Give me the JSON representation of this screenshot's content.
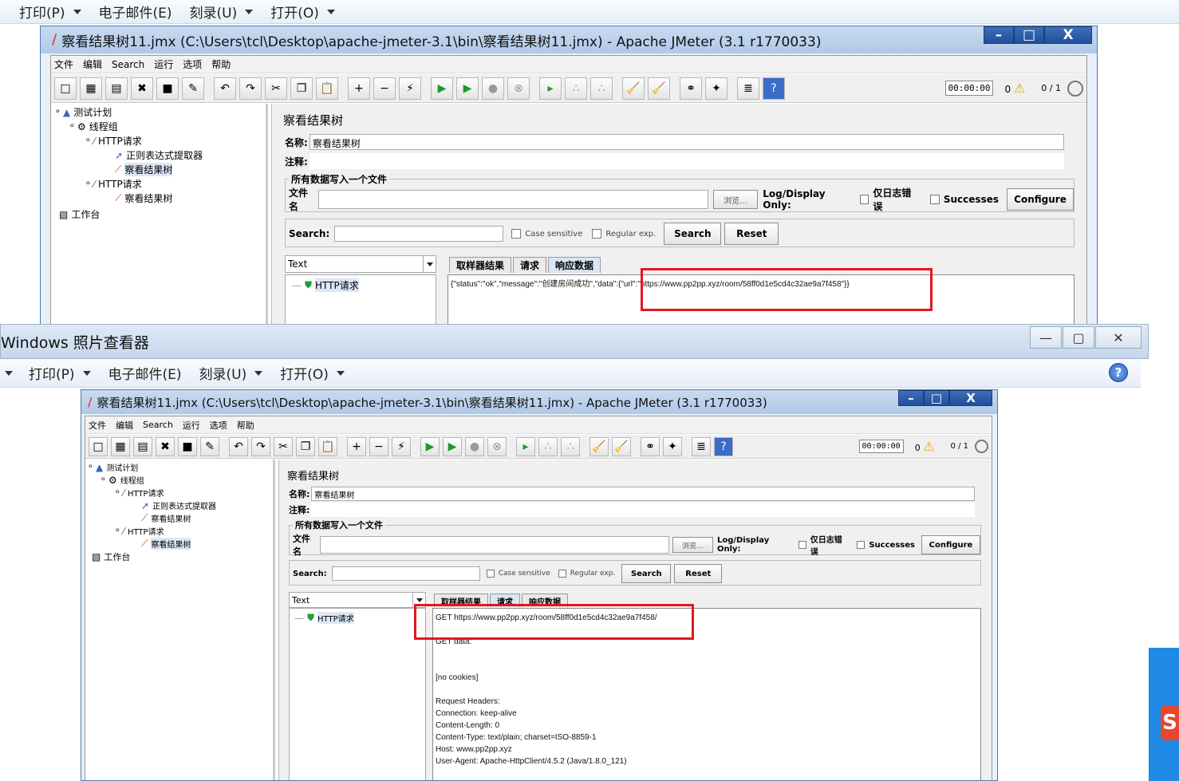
{
  "viewer": {
    "title": "Windows 照片查看器",
    "menu": [
      {
        "label": "打印(P)"
      },
      {
        "label": "电子邮件(E)"
      },
      {
        "label": "刻录(U)"
      },
      {
        "label": "打开(O)"
      }
    ]
  },
  "jmeter": {
    "title": "察看结果树11.jmx (C:\\Users\\tcl\\Desktop\\apache-jmeter-3.1\\bin\\察看结果树11.jmx) - Apache JMeter (3.1 r1770033)",
    "menu": [
      "文件",
      "编辑",
      "Search",
      "运行",
      "选项",
      "帮助"
    ],
    "timer": "00:00:00",
    "warn_count": "0",
    "thread_ratio": "0 / 1",
    "tree": [
      "测试计划",
      "线程组",
      "HTTP请求",
      "正则表达式提取器",
      "察看结果树",
      "HTTP请求",
      "察看结果树",
      "工作台"
    ],
    "panel_title": "察看结果树",
    "name_label": "名称:",
    "name_value": "察看结果树",
    "comment_label": "注释:",
    "file_group": "所有数据写入一个文件",
    "file_label": "文件名",
    "browse": "浏览...",
    "log_display": "Log/Display Only:",
    "errors_only": "仅日志错误",
    "successes": "Successes",
    "configure": "Configure",
    "search_label": "Search:",
    "case_sensitive": "Case sensitive",
    "regular_exp": "Regular exp.",
    "search_btn": "Search",
    "reset_btn": "Reset",
    "renderer": "Text",
    "result_item": "HTTP请求",
    "tabs": [
      "取样器结果",
      "请求",
      "响应数据"
    ]
  },
  "top_response": "{\"status\":\"ok\",\"message\":\"创建房间成功\",\"data\":{\"url\":\"https://www.pp2pp.xyz/room/58ff0d1e5cd4c32ae9a7f458\"}}",
  "bottom_request": [
    "GET https://www.pp2pp.xyz/room/58ff0d1e5cd4c32ae9a7f458/",
    "",
    "GET data:",
    "",
    "",
    "[no cookies]",
    "",
    "Request Headers:",
    "Connection: keep-alive",
    "Content-Length: 0",
    "Content-Type: text/plain; charset=ISO-8859-1",
    "Host: www.pp2pp.xyz",
    "User-Agent: Apache-HttpClient/4.5.2 (Java/1.8.0_121)"
  ],
  "colors": {
    "highlight_box": "#e0181e",
    "title_blue": "#4d79b0"
  }
}
